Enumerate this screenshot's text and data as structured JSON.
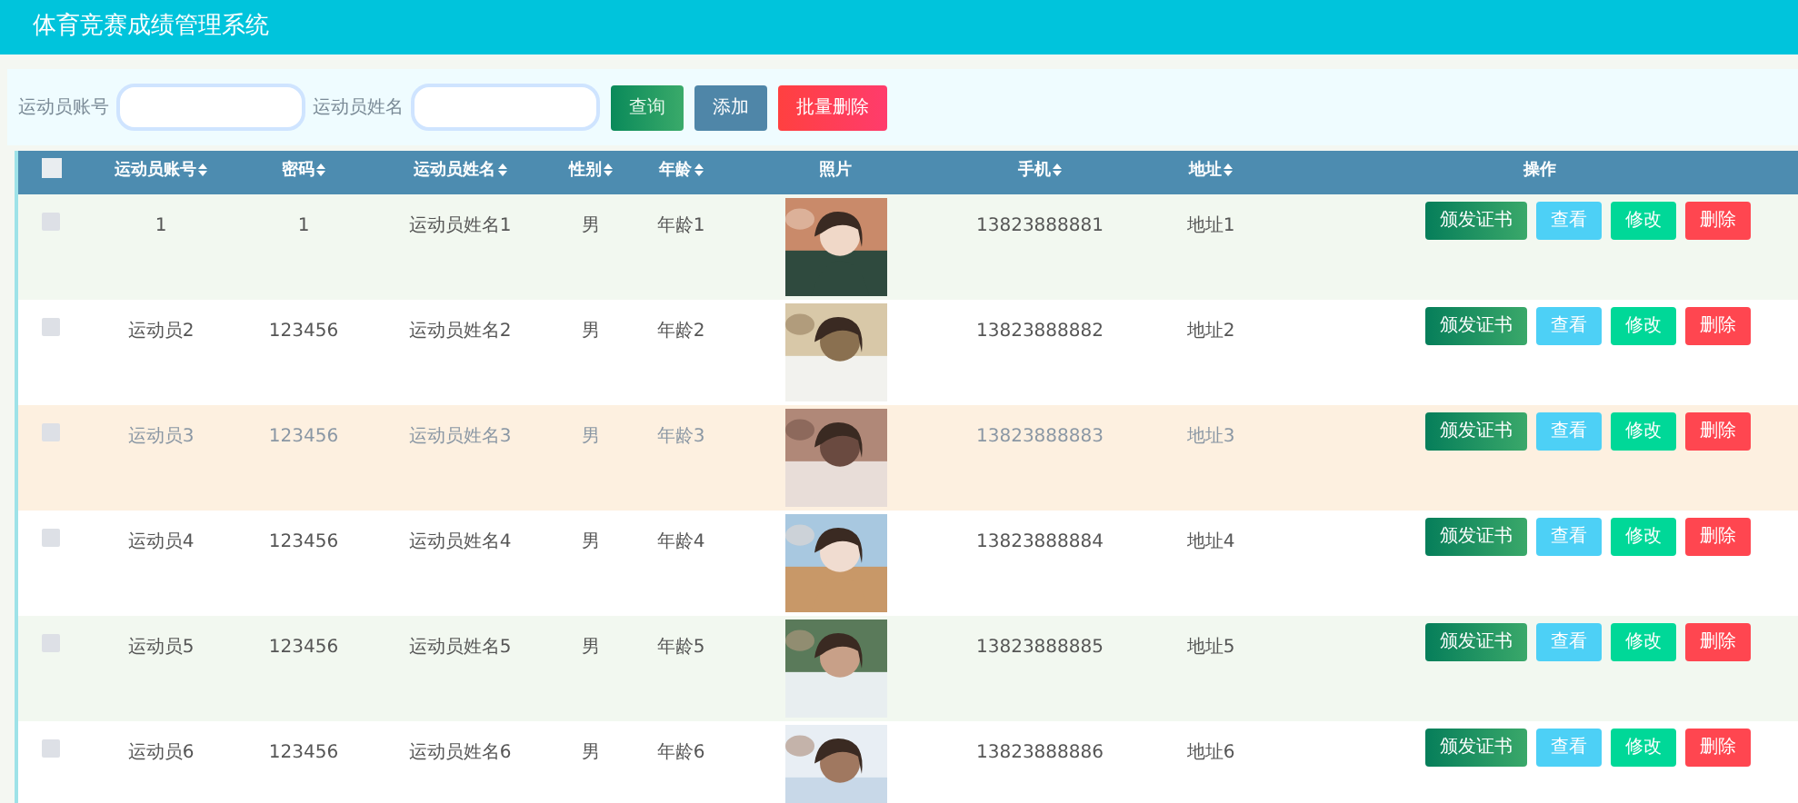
{
  "header": {
    "title": "体育竞赛成绩管理系统"
  },
  "search": {
    "fields": [
      {
        "label": "运动员账号"
      },
      {
        "label": "运动员姓名"
      }
    ],
    "buttons": [
      {
        "kind": "query",
        "label": "查询"
      },
      {
        "kind": "add",
        "label": "添加"
      },
      {
        "kind": "batch-delete",
        "label": "批量删除"
      }
    ]
  },
  "table": {
    "select_all_checked": false,
    "columns": [
      {
        "label": "运动员账号",
        "sortable": true
      },
      {
        "label": "密码",
        "sortable": true
      },
      {
        "label": "运动员姓名",
        "sortable": true
      },
      {
        "label": "性别",
        "sortable": true
      },
      {
        "label": "年龄",
        "sortable": true
      },
      {
        "label": "照片",
        "sortable": false
      },
      {
        "label": "手机",
        "sortable": true
      },
      {
        "label": "地址",
        "sortable": true
      },
      {
        "label": "操作",
        "sortable": false
      }
    ],
    "rows": [
      {
        "checked": false,
        "highlighted": false,
        "cells": [
          "1",
          "1",
          "运动员姓名1",
          "男",
          "年龄1",
          {
            "kind": "picture"
          },
          "13823888881",
          "地址1"
        ],
        "actions": [
          {
            "kind": "certificate",
            "label": "颁发证书"
          },
          {
            "kind": "view",
            "label": "查看"
          },
          {
            "kind": "edit",
            "label": "修改"
          },
          {
            "kind": "delete",
            "label": "删除"
          }
        ]
      },
      {
        "checked": false,
        "highlighted": false,
        "cells": [
          "运动员2",
          "123456",
          "运动员姓名2",
          "男",
          "年龄2",
          {
            "kind": "picture"
          },
          "13823888882",
          "地址2"
        ],
        "actions": [
          {
            "kind": "certificate",
            "label": "颁发证书"
          },
          {
            "kind": "view",
            "label": "查看"
          },
          {
            "kind": "edit",
            "label": "修改"
          },
          {
            "kind": "delete",
            "label": "删除"
          }
        ]
      },
      {
        "checked": false,
        "highlighted": true,
        "cells": [
          "运动员3",
          "123456",
          "运动员姓名3",
          "男",
          "年龄3",
          {
            "kind": "picture"
          },
          "13823888883",
          "地址3"
        ],
        "actions": [
          {
            "kind": "certificate",
            "label": "颁发证书"
          },
          {
            "kind": "view",
            "label": "查看"
          },
          {
            "kind": "edit",
            "label": "修改"
          },
          {
            "kind": "delete",
            "label": "删除"
          }
        ]
      },
      {
        "checked": false,
        "highlighted": false,
        "cells": [
          "运动员4",
          "123456",
          "运动员姓名4",
          "男",
          "年龄4",
          {
            "kind": "picture"
          },
          "13823888884",
          "地址4"
        ],
        "actions": [
          {
            "kind": "certificate",
            "label": "颁发证书"
          },
          {
            "kind": "view",
            "label": "查看"
          },
          {
            "kind": "edit",
            "label": "修改"
          },
          {
            "kind": "delete",
            "label": "删除"
          }
        ]
      },
      {
        "checked": false,
        "highlighted": false,
        "cells": [
          "运动员5",
          "123456",
          "运动员姓名5",
          "男",
          "年龄5",
          {
            "kind": "picture"
          },
          "13823888885",
          "地址5"
        ],
        "actions": [
          {
            "kind": "certificate",
            "label": "颁发证书"
          },
          {
            "kind": "view",
            "label": "查看"
          },
          {
            "kind": "edit",
            "label": "修改"
          },
          {
            "kind": "delete",
            "label": "删除"
          }
        ]
      },
      {
        "checked": false,
        "highlighted": false,
        "cells": [
          "运动员6",
          "123456",
          "运动员姓名6",
          "男",
          "年龄6",
          {
            "kind": "picture"
          },
          "13823888886",
          "地址6"
        ],
        "actions": [
          {
            "kind": "certificate",
            "label": "颁发证书"
          },
          {
            "kind": "view",
            "label": "查看"
          },
          {
            "kind": "edit",
            "label": "修改"
          },
          {
            "kind": "delete",
            "label": "删除"
          }
        ]
      }
    ]
  }
}
